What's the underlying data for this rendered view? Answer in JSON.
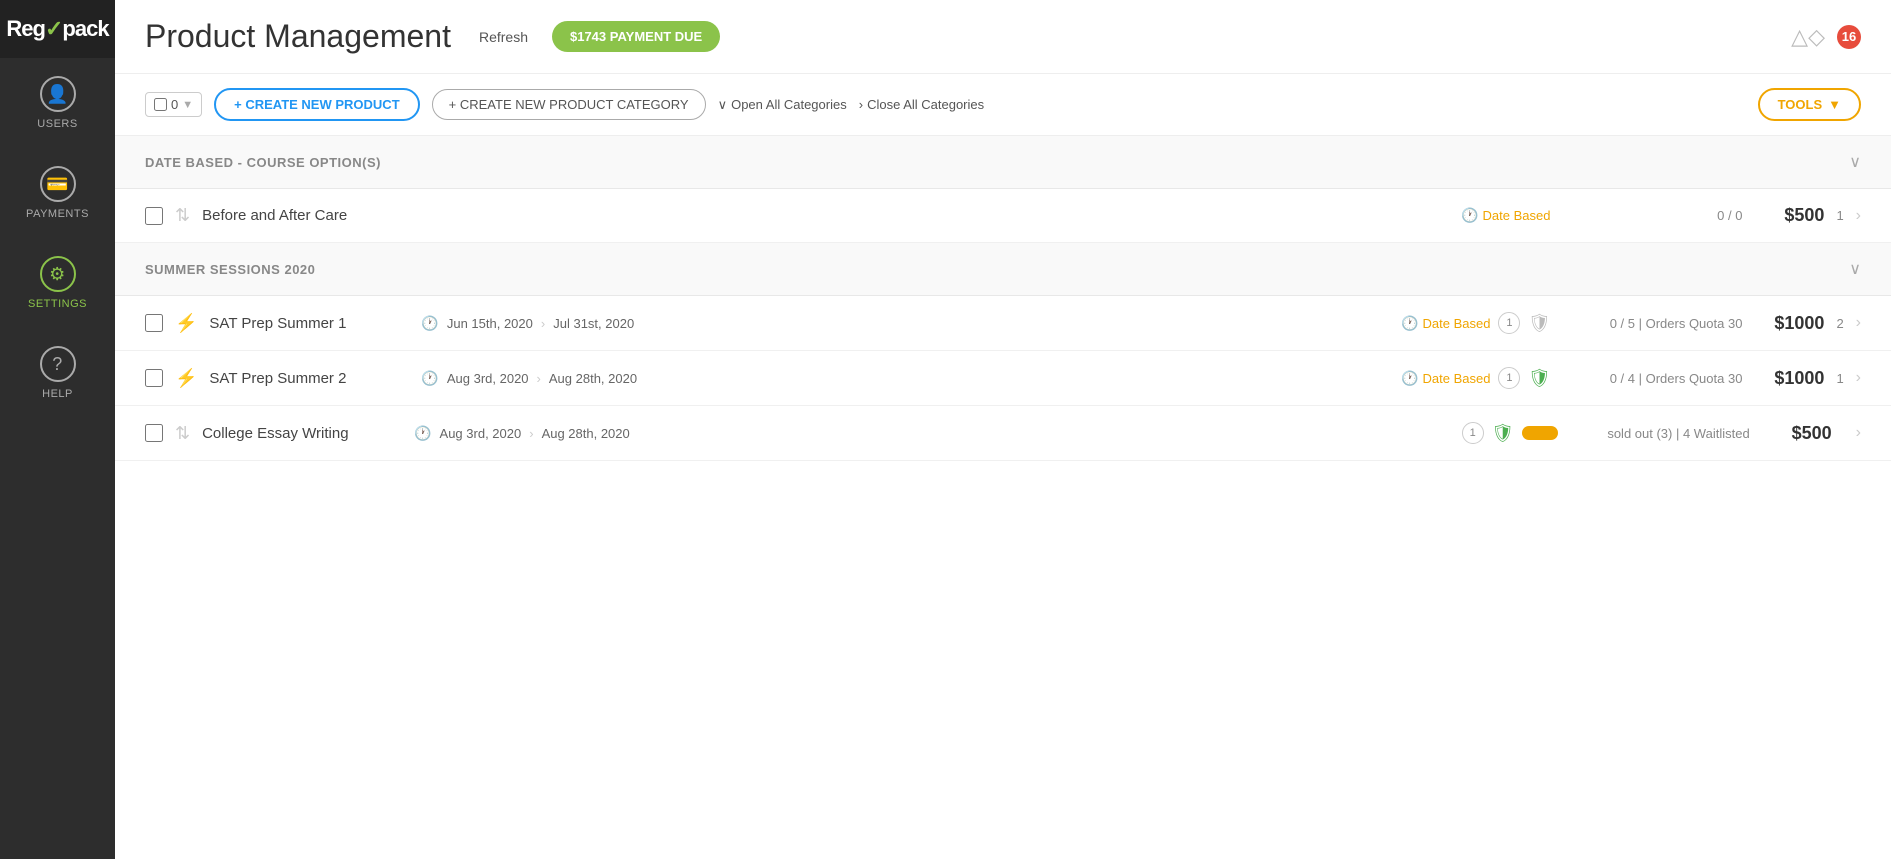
{
  "sidebar": {
    "logo": "Reg✓pack",
    "items": [
      {
        "id": "users",
        "label": "USERS",
        "icon": "👤",
        "active": false
      },
      {
        "id": "payments",
        "label": "PAYMENTS",
        "icon": "💰",
        "active": false
      },
      {
        "id": "settings",
        "label": "SETTINGS",
        "icon": "⚙",
        "active": true
      },
      {
        "id": "help",
        "label": "HELP",
        "icon": "?",
        "active": false
      }
    ]
  },
  "header": {
    "title": "Product Management",
    "refresh_label": "Refresh",
    "payment_due": "$1743 PAYMENT DUE",
    "notification_count": "16"
  },
  "toolbar": {
    "select_count": "0",
    "create_product_label": "+ CREATE NEW PRODUCT",
    "create_category_label": "+ CREATE NEW PRODUCT CATEGORY",
    "open_all_label": "Open All Categories",
    "close_all_label": "Close All Categories",
    "tools_label": "TOOLS"
  },
  "categories": [
    {
      "id": "date-based-course",
      "title": "DATE BASED - COURSE OPTION(S)",
      "products": [
        {
          "id": "before-after-care",
          "name": "Before and After Care",
          "dates": null,
          "tag": "Date Based",
          "badge": null,
          "shield": null,
          "shield_color": null,
          "stats": "0 / 0",
          "price": "$500",
          "count": "1",
          "icon_type": "arrow"
        }
      ]
    },
    {
      "id": "summer-sessions-2020",
      "title": "SUMMER SESSIONS 2020",
      "products": [
        {
          "id": "sat-prep-summer-1",
          "name": "SAT Prep Summer 1",
          "date_start": "Jun 15th, 2020",
          "date_end": "Jul 31st, 2020",
          "tag": "Date Based",
          "badge": "1",
          "shield": true,
          "shield_color": "grey",
          "stats": "0 / 5 | Orders Quota 30",
          "price": "$1000",
          "count": "2",
          "icon_type": "lightning"
        },
        {
          "id": "sat-prep-summer-2",
          "name": "SAT Prep Summer 2",
          "date_start": "Aug 3rd, 2020",
          "date_end": "Aug 28th, 2020",
          "tag": "Date Based",
          "badge": "1",
          "shield": true,
          "shield_color": "green",
          "stats": "0 / 4 | Orders Quota 30",
          "price": "$1000",
          "count": "1",
          "icon_type": "lightning"
        },
        {
          "id": "college-essay-writing",
          "name": "College Essay Writing",
          "date_start": "Aug 3rd, 2020",
          "date_end": "Aug 28th, 2020",
          "tag": null,
          "badge": "1",
          "shield": true,
          "shield_color": "green",
          "pill": true,
          "stats": "sold out (3) | 4 Waitlisted",
          "price": "$500",
          "count": null,
          "icon_type": "arrow"
        }
      ]
    }
  ]
}
